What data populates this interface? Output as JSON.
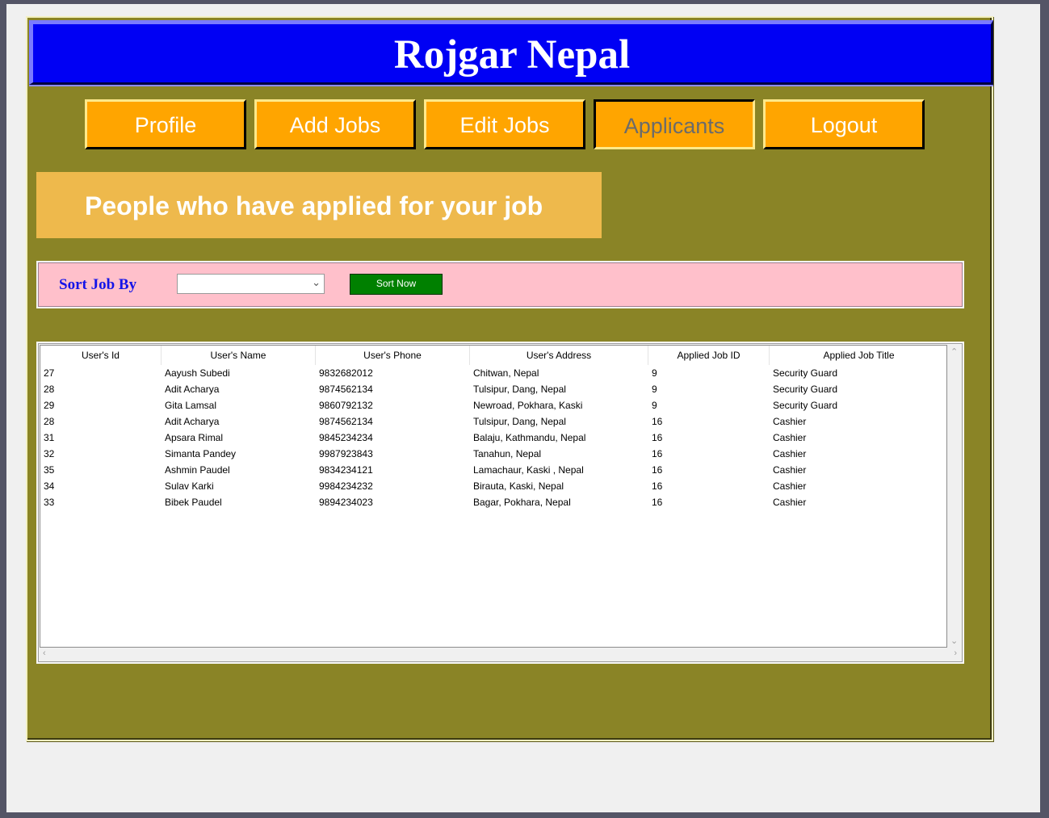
{
  "app": {
    "title": "Rojgar Nepal"
  },
  "nav": {
    "items": [
      {
        "label": "Profile",
        "active": false
      },
      {
        "label": "Add Jobs",
        "active": false
      },
      {
        "label": "Edit Jobs",
        "active": false
      },
      {
        "label": "Applicants",
        "active": true
      },
      {
        "label": "Logout",
        "active": false
      }
    ]
  },
  "banner": {
    "text": "People who have applied for your job"
  },
  "sort": {
    "label": "Sort Job By",
    "selected_value": "",
    "button_label": "Sort Now"
  },
  "table": {
    "columns": [
      "User's Id",
      "User's Name",
      "User's Phone",
      "User's Address",
      "Applied Job ID",
      "Applied Job Title"
    ],
    "rows": [
      [
        "27",
        "Aayush Subedi",
        "9832682012",
        "Chitwan, Nepal",
        "9",
        "Security Guard"
      ],
      [
        "28",
        "Adit Acharya",
        "9874562134",
        "Tulsipur, Dang, Nepal",
        "9",
        "Security Guard"
      ],
      [
        "29",
        "Gita Lamsal",
        "9860792132",
        "Newroad, Pokhara, Kaski",
        "9",
        "Security Guard"
      ],
      [
        "28",
        "Adit Acharya",
        "9874562134",
        "Tulsipur, Dang, Nepal",
        "16",
        "Cashier"
      ],
      [
        "31",
        "Apsara Rimal",
        "9845234234",
        "Balaju, Kathmandu, Nepal",
        "16",
        "Cashier"
      ],
      [
        "32",
        "Simanta Pandey",
        "9987923843",
        "Tanahun, Nepal",
        "16",
        "Cashier"
      ],
      [
        "35",
        "Ashmin Paudel",
        "9834234121",
        "Lamachaur, Kaski , Nepal",
        "16",
        "Cashier"
      ],
      [
        "34",
        "Sulav Karki",
        "9984234232",
        "Birauta, Kaski, Nepal",
        "16",
        "Cashier"
      ],
      [
        "33",
        "Bibek Paudel",
        "9894234023",
        "Bagar, Pokhara, Nepal",
        "16",
        "Cashier"
      ]
    ]
  },
  "icons": {
    "select_chevron": "chevron-down-icon",
    "scroll_up": "scroll-up-icon",
    "scroll_down": "scroll-down-icon",
    "scroll_left": "scroll-left-icon",
    "scroll_right": "scroll-right-icon"
  },
  "colors": {
    "header_bg": "#0000f4",
    "panel_bg": "#8a8426",
    "nav_button_bg": "#ffa500",
    "banner_bg": "#eeb94c",
    "sort_bar_bg": "#ffc0cb",
    "sort_label": "#1414e8",
    "sort_button_bg": "#008000"
  }
}
